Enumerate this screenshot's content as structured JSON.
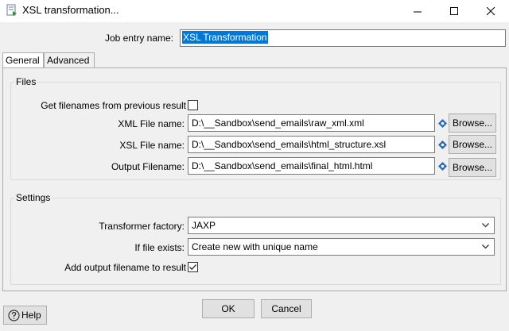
{
  "window": {
    "title": "XSL transformation...",
    "icon": "xsl-transform-icon"
  },
  "job_entry": {
    "label": "Job entry name:",
    "value": "XSL Transformation"
  },
  "tabs": [
    {
      "label": "General",
      "active": true
    },
    {
      "label": "Advanced",
      "active": false
    }
  ],
  "files": {
    "group_title": "Files",
    "prev_result_label": "Get filenames from previous result",
    "prev_result_checked": false,
    "xml": {
      "label": "XML File name:",
      "value": "D:\\__Sandbox\\send_emails\\raw_xml.xml"
    },
    "xsl": {
      "label": "XSL File name:",
      "value": "D:\\__Sandbox\\send_emails\\html_structure.xsl"
    },
    "output": {
      "label": "Output Filename:",
      "value": "D:\\__Sandbox\\send_emails\\final_html.html"
    },
    "browse_label": "Browse..."
  },
  "settings": {
    "group_title": "Settings",
    "factory": {
      "label": "Transformer factory:",
      "value": "JAXP"
    },
    "exists": {
      "label": "If file exists:",
      "value": "Create new with unique name"
    },
    "add_output": {
      "label": "Add output filename to result",
      "checked": true
    }
  },
  "buttons": {
    "ok": "OK",
    "cancel": "Cancel",
    "help": "Help"
  },
  "colors": {
    "selection": "#0078d7",
    "dialog_bg": "#f0f0f0",
    "variable_icon": "#2b6cb0"
  }
}
